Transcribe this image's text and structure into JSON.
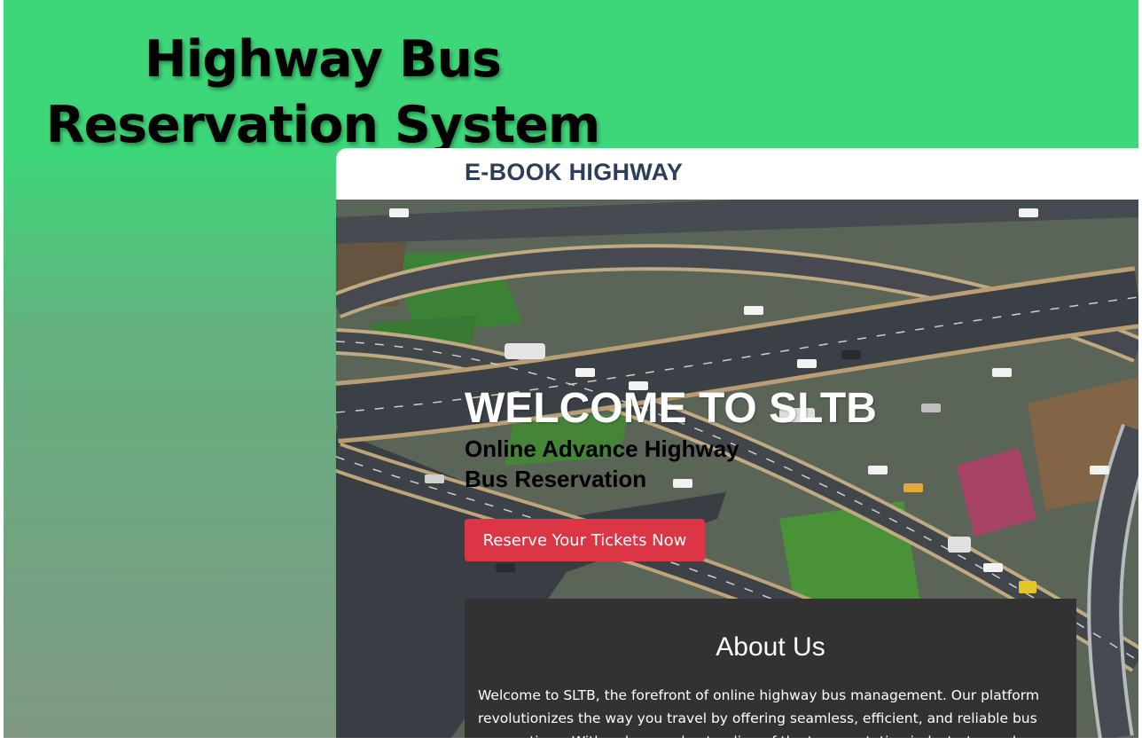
{
  "slide": {
    "title": "Highway Bus Reservation System",
    "colors": {
      "background_top": "#3dd779",
      "background_bottom": "#7f9883"
    }
  },
  "site": {
    "brand": "E-BOOK HIGHWAY",
    "hero": {
      "background_image": "aerial-highway-interchange",
      "title": "WELCOME TO SLTB",
      "subtitle": "Online Advance Highway Bus Reservation",
      "cta_label": "Reserve Your Tickets Now"
    },
    "about": {
      "heading": "About Us",
      "text": "Welcome to SLTB, the forefront of online highway bus management. Our platform revolutionizes the way you travel by offering seamless, efficient, and reliable bus reservations. With a deep understanding of the transportation industry's needs, we aim"
    },
    "colors": {
      "brand": "#2c3e5c",
      "cta": "#dc3545",
      "about_bg": "#323232"
    }
  }
}
